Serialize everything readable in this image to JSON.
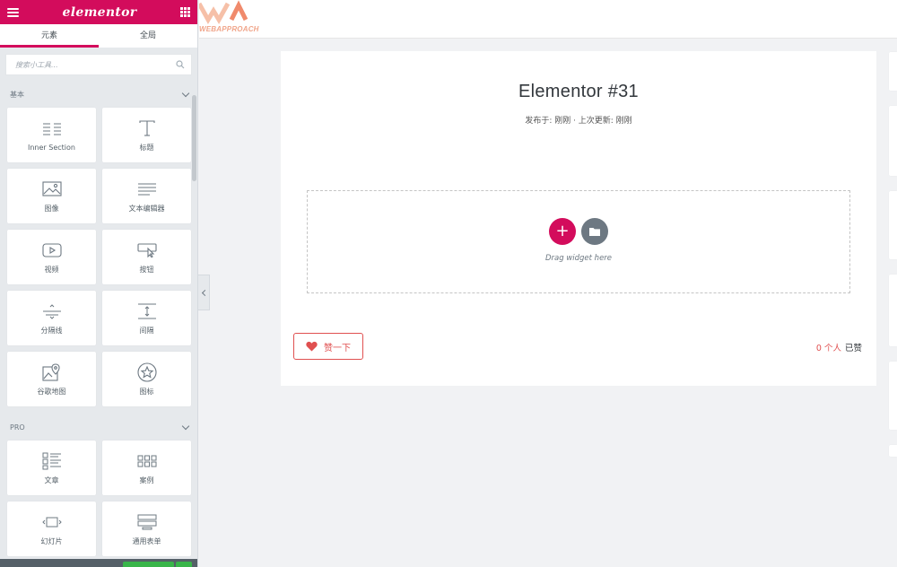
{
  "panel": {
    "logo": "elementor",
    "tabs": [
      {
        "label": "元素",
        "active": true
      },
      {
        "label": "全局",
        "active": false
      }
    ],
    "search": {
      "placeholder": "搜索小工具..."
    },
    "categories": [
      {
        "title": "基本",
        "widgets": [
          {
            "label": "Inner Section",
            "icon": "inner-section-icon"
          },
          {
            "label": "标题",
            "icon": "heading-icon"
          },
          {
            "label": "图像",
            "icon": "image-icon"
          },
          {
            "label": "文本编辑器",
            "icon": "text-editor-icon"
          },
          {
            "label": "视频",
            "icon": "video-icon"
          },
          {
            "label": "按钮",
            "icon": "button-icon"
          },
          {
            "label": "分隔线",
            "icon": "divider-icon"
          },
          {
            "label": "间隔",
            "icon": "spacer-icon"
          },
          {
            "label": "谷歌地图",
            "icon": "google-maps-icon"
          },
          {
            "label": "图标",
            "icon": "star-icon"
          }
        ]
      },
      {
        "title": "PRO",
        "widgets": [
          {
            "label": "文章",
            "icon": "posts-icon"
          },
          {
            "label": "案例",
            "icon": "portfolio-icon"
          },
          {
            "label": "幻灯片",
            "icon": "slides-icon"
          },
          {
            "label": "通用表单",
            "icon": "form-icon"
          }
        ]
      }
    ]
  },
  "site": {
    "logo_text": "WEBAPPROACH"
  },
  "post": {
    "title": "Elementor #31",
    "meta": "发布于: 刚刚 · 上次更新: 刚刚",
    "drop_hint": "Drag widget here",
    "add_symbol": "+"
  },
  "like": {
    "button_label": "赞一下",
    "count": "0 个人",
    "suffix": "已赞"
  },
  "colors": {
    "brand": "#d30c5c",
    "like": "#e05050",
    "publish": "#39b54a"
  }
}
